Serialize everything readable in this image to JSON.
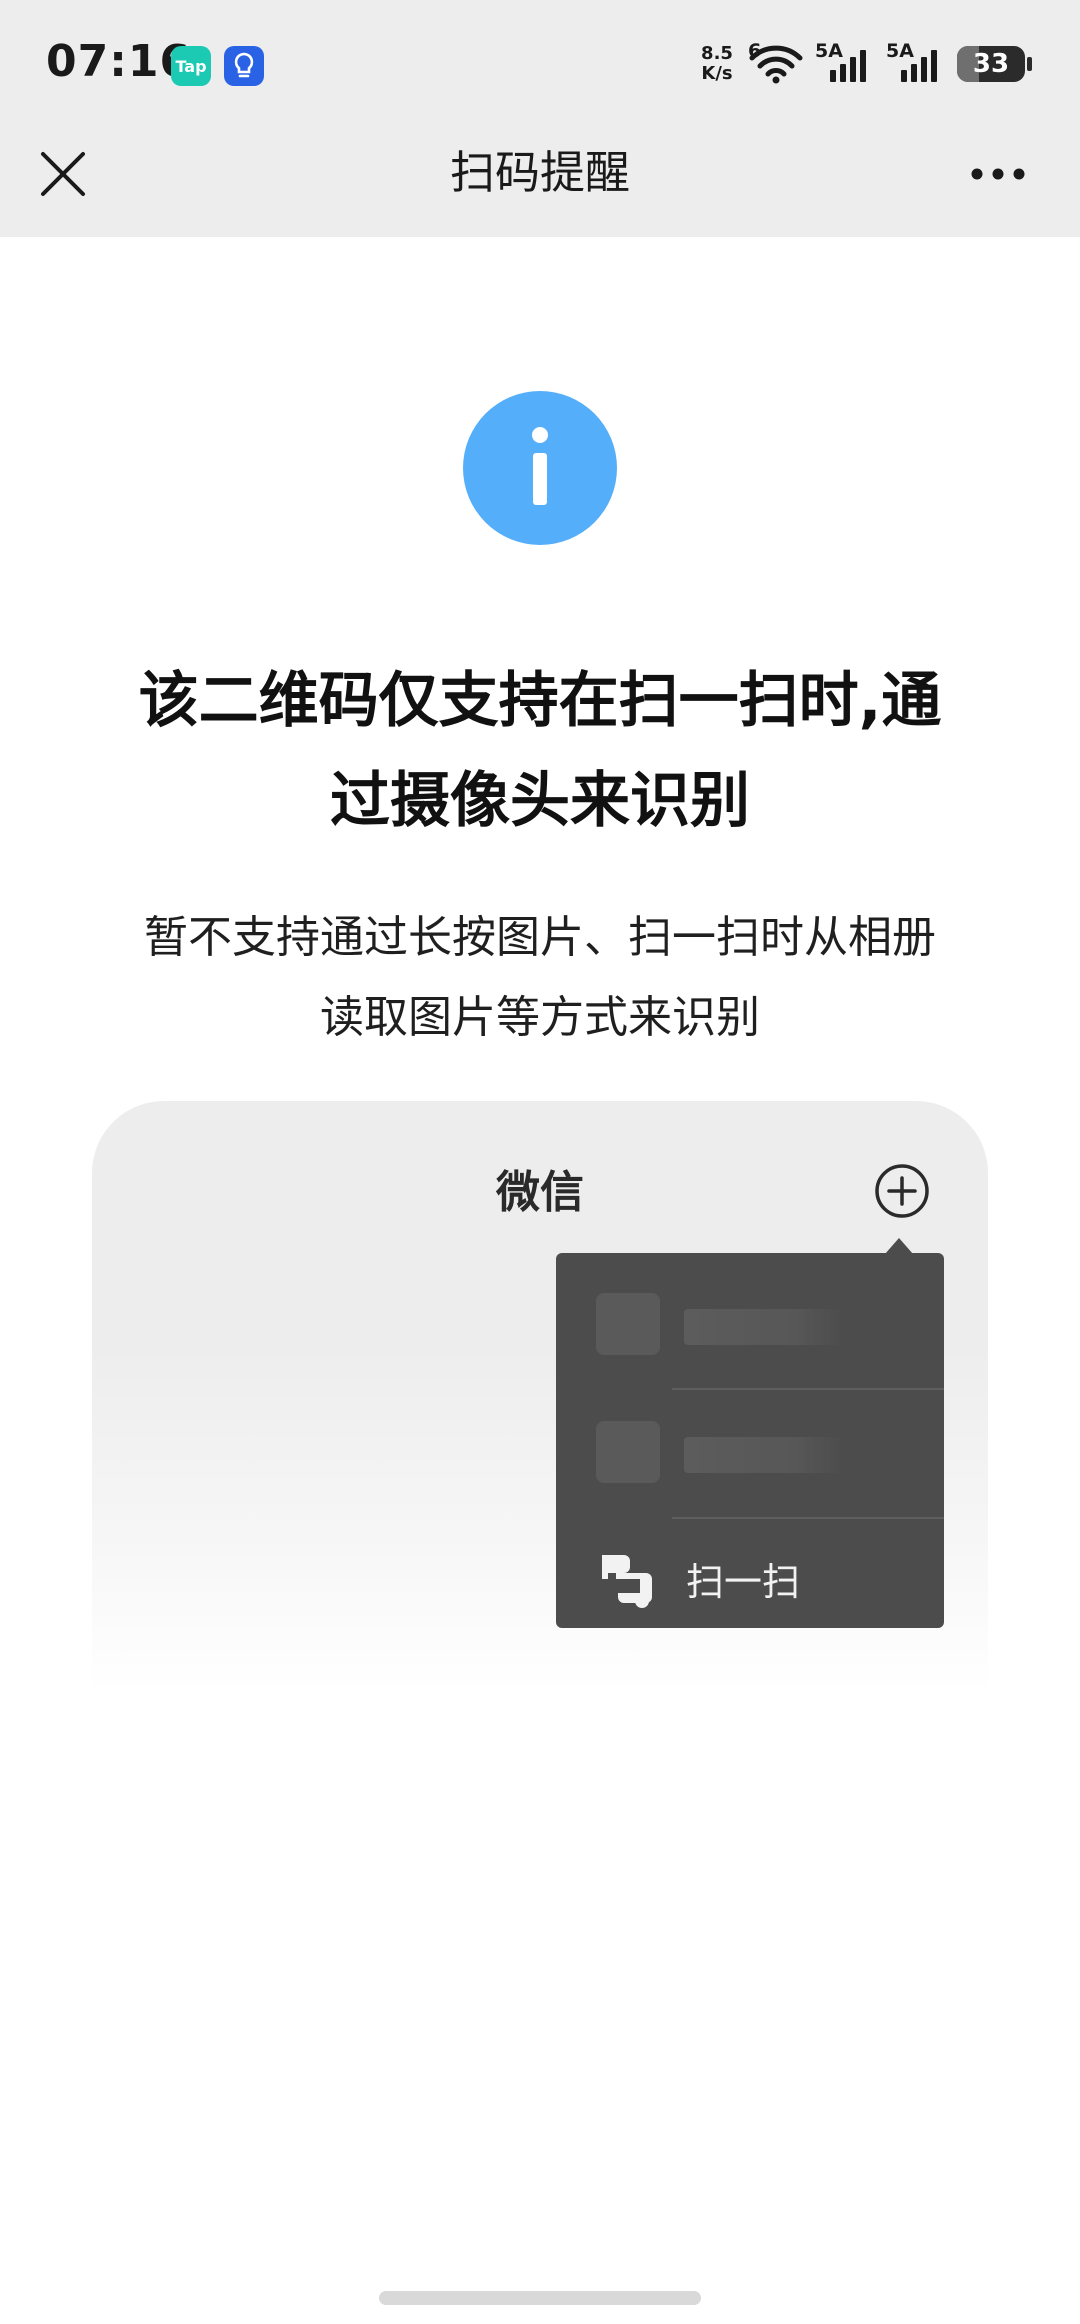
{
  "status_bar": {
    "time": "07:16",
    "app_badge_tap": "Tap",
    "net_speed_value": "8.5",
    "net_speed_unit": "K/s",
    "wifi_label": "6",
    "signal1_label": "5A",
    "signal2_label": "5A",
    "battery_level": "33",
    "battery_percent": 33
  },
  "nav": {
    "title": "扫码提醒"
  },
  "notice": {
    "headline_line1": "该二维码仅支持在扫一扫时,通",
    "headline_line2": "过摄像头来识别",
    "subtext_line1": "暂不支持通过长按图片、扫一扫时从相册",
    "subtext_line2": "读取图片等方式来识别"
  },
  "illustration": {
    "app_title": "微信",
    "menu_scan_label": "扫一扫"
  },
  "colors": {
    "info_blue": "#55aefa",
    "nav_bg": "#ededed",
    "menu_bg": "#4c4c4c"
  },
  "icons": {
    "close": "close-icon",
    "more": "more-icon",
    "info": "info-icon",
    "plus": "plus-circle-icon",
    "scan": "scan-icon"
  }
}
